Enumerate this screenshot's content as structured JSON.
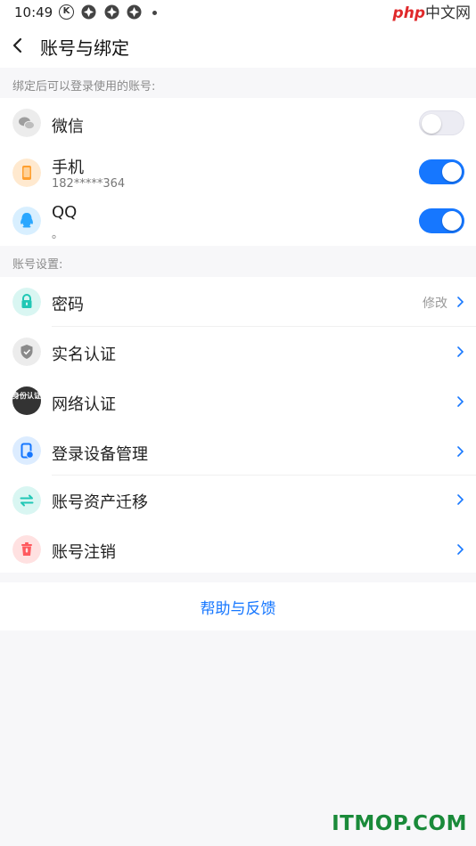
{
  "status_bar": {
    "time": "10:49",
    "k_badge": "K",
    "watermark_php": "php",
    "watermark_cn": "中文网"
  },
  "header": {
    "title": "账号与绑定"
  },
  "binding_section": {
    "label": "绑定后可以登录使用的账号:",
    "items": [
      {
        "title": "微信",
        "subtitle": "",
        "enabled": false,
        "icon": "wechat-icon",
        "color": "#9e9e9e"
      },
      {
        "title": "手机",
        "subtitle": "182*****364",
        "enabled": true,
        "icon": "phone-icon",
        "color": "#ff9f2e"
      },
      {
        "title": "QQ",
        "subtitle": "。",
        "enabled": true,
        "icon": "qq-icon",
        "color": "#2aa7ff"
      }
    ]
  },
  "settings_section": {
    "label": "账号设置:",
    "items": [
      {
        "title": "密码",
        "value": "修改",
        "icon": "lock-icon",
        "color": "#21c7b5"
      },
      {
        "title": "实名认证",
        "value": "",
        "icon": "shield-icon",
        "color": "#8a8a8a"
      },
      {
        "title": "网络认证",
        "value": "",
        "icon": "network-id-icon",
        "badge": "身份认证",
        "color": "#333333"
      },
      {
        "title": "登录设备管理",
        "value": "",
        "icon": "device-icon",
        "color": "#1677ff"
      },
      {
        "title": "账号资产迁移",
        "value": "",
        "icon": "transfer-icon",
        "color": "#21c7b5"
      },
      {
        "title": "账号注销",
        "value": "",
        "icon": "trash-icon",
        "color": "#ff5a5f"
      }
    ]
  },
  "help": {
    "label": "帮助与反馈"
  },
  "watermark_bottom": "ITMOP.COM",
  "colors": {
    "accent": "#1677ff",
    "background": "#f7f7f9"
  }
}
